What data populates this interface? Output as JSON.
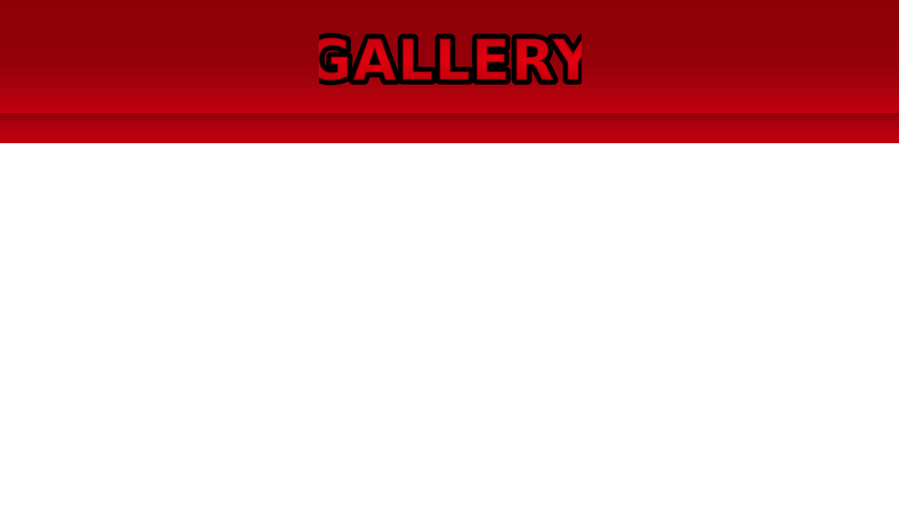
{
  "header": {
    "logo_text": "GALLERY"
  },
  "colors": {
    "header_dark": "#8e0008",
    "header_light": "#c6000f",
    "logo_fill": "#e0000f",
    "logo_outline": "#000000",
    "content_bg": "#ffffff"
  }
}
